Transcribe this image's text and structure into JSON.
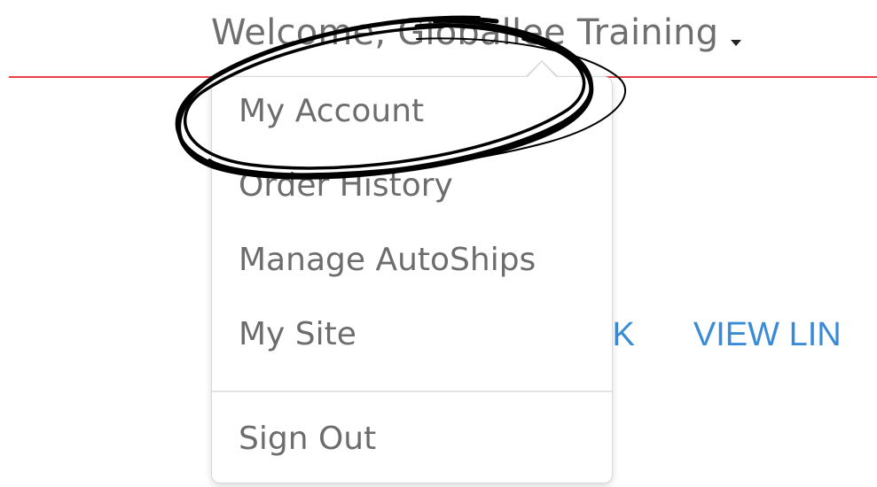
{
  "header": {
    "welcome_text": "Welcome, Globallee Training"
  },
  "background_links": {
    "link_1": "IK",
    "link_2": "VIEW LIN"
  },
  "account_menu": {
    "items": [
      {
        "label": "My Account"
      },
      {
        "label": "Order History"
      },
      {
        "label": "Manage AutoShips"
      },
      {
        "label": "My Site"
      },
      {
        "label": "Sign Out"
      }
    ]
  },
  "colors": {
    "accent_rule": "#e74044",
    "link_blue": "#3a8bd6",
    "menu_text": "#6d6d6d"
  },
  "icons": {
    "dropdown": "caret-down-icon"
  }
}
